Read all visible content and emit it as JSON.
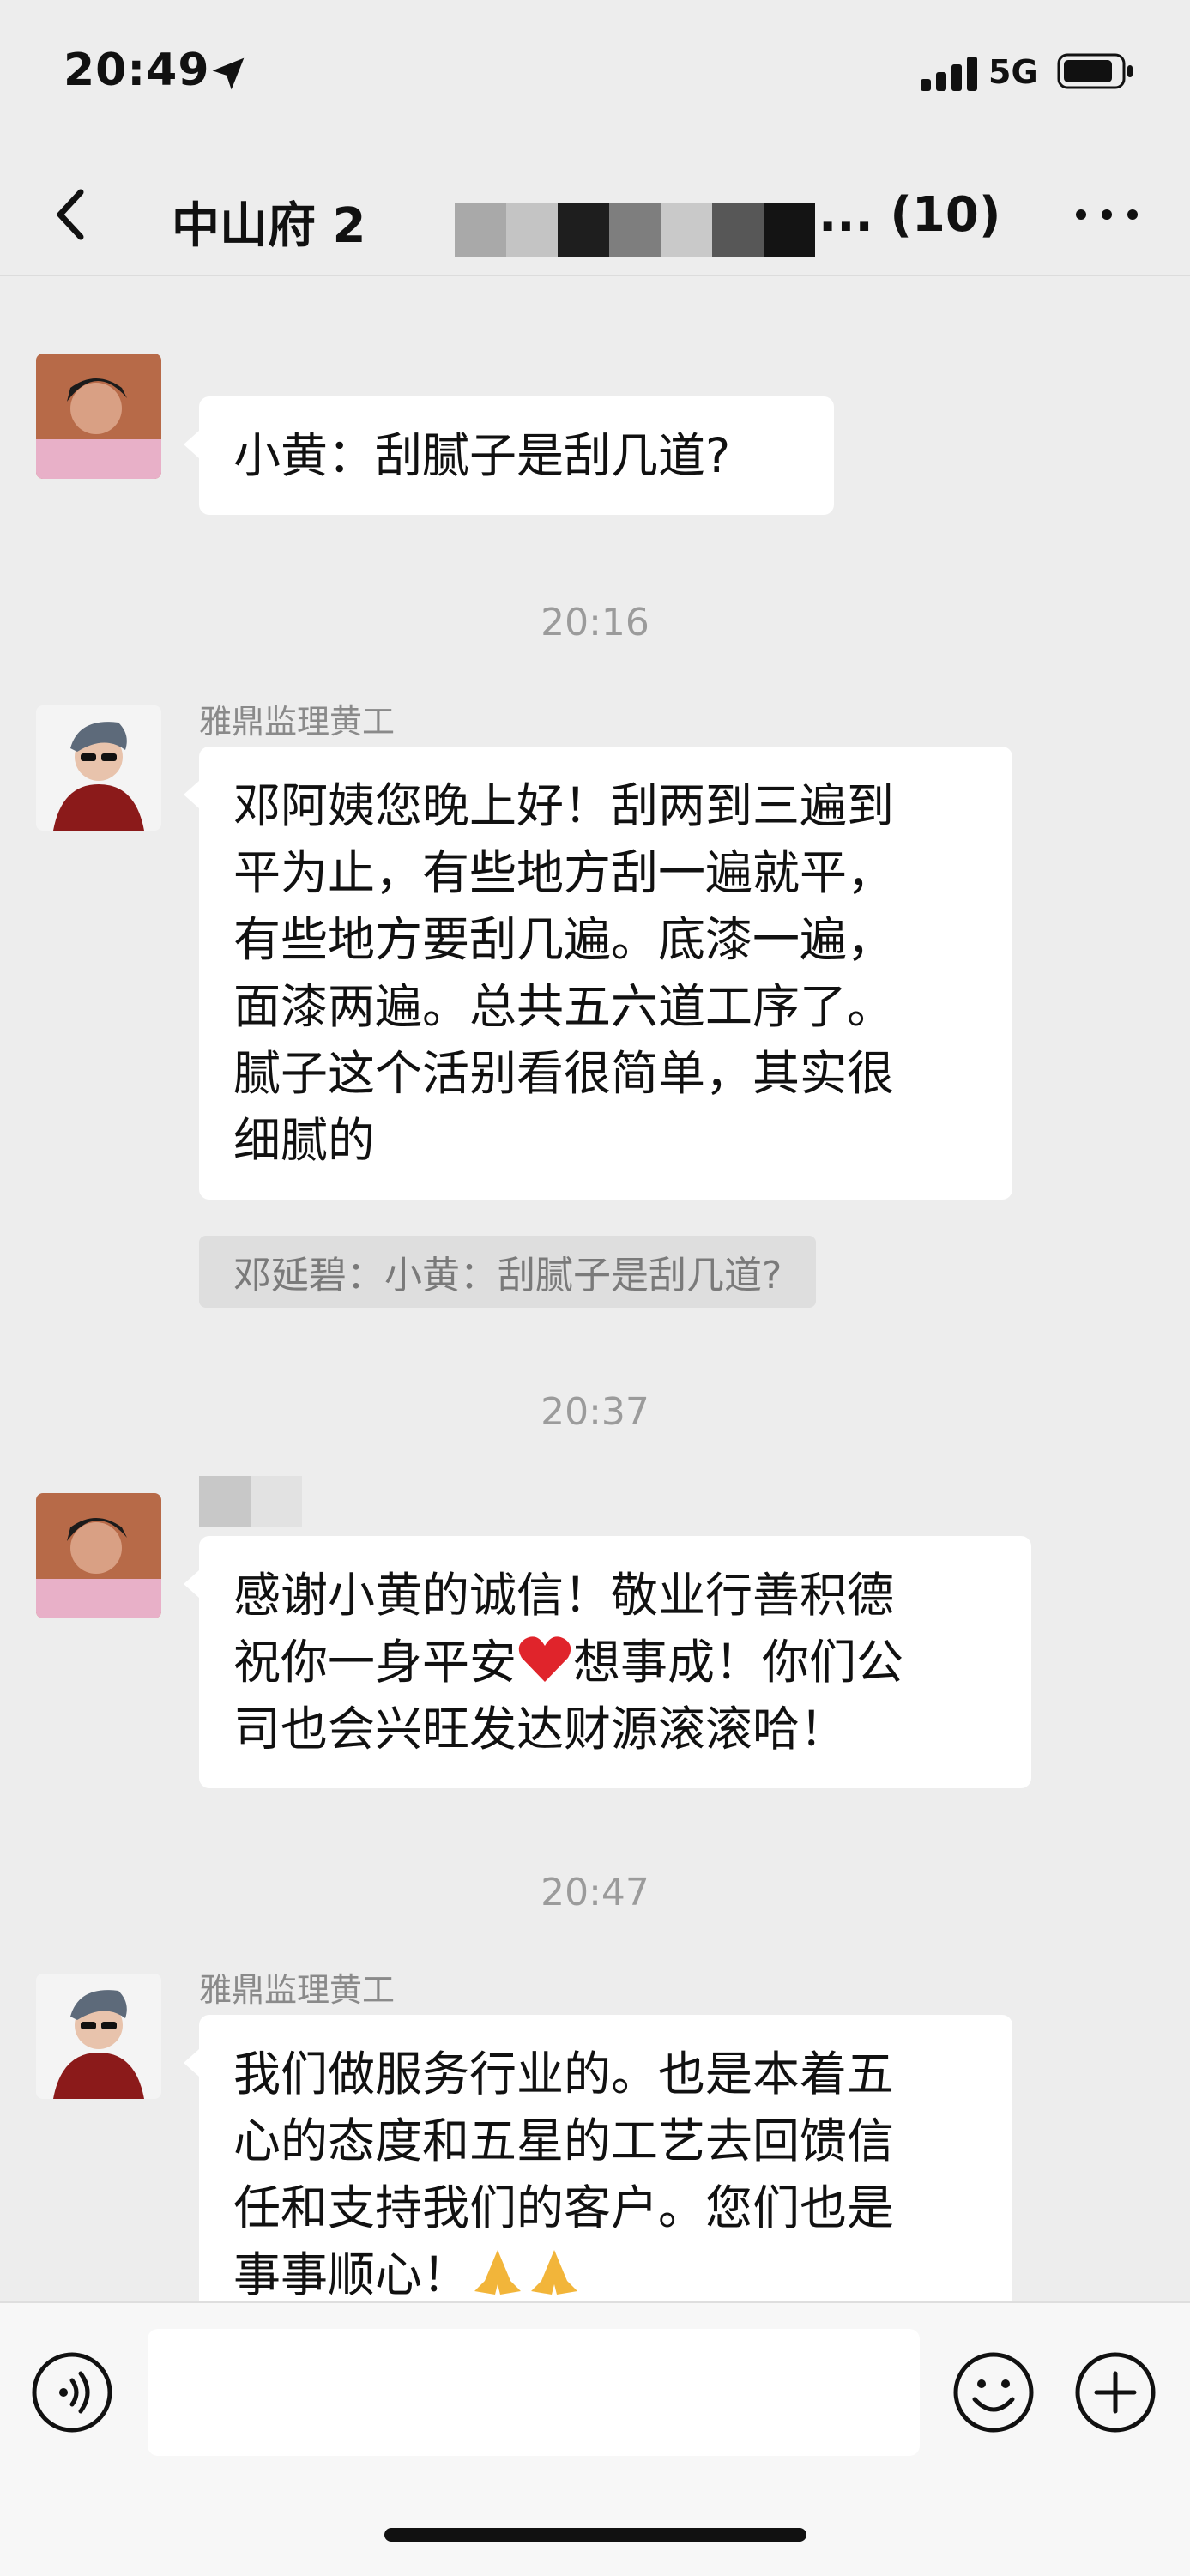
{
  "status_bar": {
    "time": "20:49",
    "network": "5G"
  },
  "header": {
    "title_visible": "中山府 2",
    "title_suffix": "... (10)"
  },
  "messages": [
    {
      "timestamp": "",
      "sender": "",
      "text": "小黄：刮腻子是刮几道?",
      "avatar": "avatar-woman"
    },
    {
      "timestamp": "20:16",
      "sender": "雅鼎监理黄工",
      "lines": [
        "邓阿姨您晚上好！刮两到三遍到",
        "平为止，有些地方刮一遍就平，",
        "有些地方要刮几遍。底漆一遍，",
        "面漆两遍。总共五六道工序了。",
        "腻子这个活别看很简单，其实很",
        "细腻的"
      ],
      "quote": "邓延碧：小黄：刮腻子是刮几道?",
      "avatar": "avatar-man"
    },
    {
      "timestamp": "20:37",
      "sender": "",
      "lines_a": "感谢小黄的诚信！敬业行善积德",
      "line_b_pre": "祝你一身平安",
      "line_b_post": "想事成！你们公",
      "line_c": "司也会兴旺发达财源滚滚哈！",
      "emoji": "red-heart",
      "avatar": "avatar-woman"
    },
    {
      "timestamp": "20:47",
      "sender": "雅鼎监理黄工",
      "lines": [
        "我们做服务行业的。也是本着五",
        "心的态度和五星的工艺去回馈信",
        "任和支持我们的客户。您们也是"
      ],
      "last_line": "事事顺心！",
      "emoji": "folded-hands",
      "avatar": "avatar-man"
    }
  ],
  "input": {
    "placeholder": ""
  },
  "icons": {
    "back": "chevron-left-icon",
    "more": "more-dots-icon",
    "voice": "voice-icon",
    "emoji": "emoji-icon",
    "plus": "plus-icon",
    "location": "location-arrow-icon"
  },
  "colors": {
    "background": "#ededed",
    "bubble": "#ffffff",
    "quote_bg": "#dedede",
    "timestamp": "#9b9b9b"
  }
}
